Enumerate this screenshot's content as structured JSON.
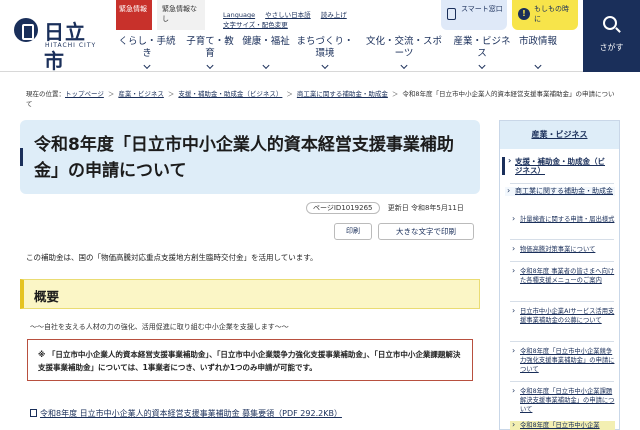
{
  "header": {
    "logo_title": "日立市",
    "logo_sub": "HITACHI CITY",
    "emergency_label": "緊急情報",
    "emergency_status": "緊急情報なし",
    "util_links": [
      "Language",
      "やさしい日本語",
      "読み上げ",
      "文字サイズ・配色変更"
    ],
    "smart_label": "スマート窓口",
    "if_label": "もしもの時に",
    "if_icon": "!",
    "search_label": "さがす"
  },
  "gnav": [
    {
      "label": "くらし・手続き"
    },
    {
      "label": "子育て・教育"
    },
    {
      "label": "健康・福祉"
    },
    {
      "label": "まちづくり・環境"
    },
    {
      "label": "文化・交流・スポーツ"
    },
    {
      "label": "産業・ビジネス"
    },
    {
      "label": "市政情報"
    }
  ],
  "breadcrumb": {
    "prefix": "現在の位置：",
    "items": [
      "トップページ",
      "産業・ビジネス",
      "支援・補助金・助成金（ビジネス）",
      "商工業に関する補助金・助成金"
    ],
    "current": "令和8年度「日立市中小企業人的資本経営支援事業補助金」の申請について",
    "separator": "＞"
  },
  "main": {
    "title": "令和8年度「日立市中小企業人的資本経営支援事業補助金」の申請について",
    "page_id": "ページID1019265",
    "updated": "更新日 令和8年5月11日",
    "print_label": "印刷",
    "print_big_label": "大きな文字で印刷",
    "intro": "この補助金は、国の「物価高騰対応重点支援地方創生臨時交付金」を活用しています。",
    "section_title": "概要",
    "subcopy": "～～自社を支える人材の力の強化、活用促進に取り組む中小企業を支援します～～",
    "notice": "※ 「日立市中小企業人的資本経営支援事業補助金」、「日立市中小企業競争力強化支援事業補助金」、「日立市中小企業課題解決支援事業補助金」については、1事業者につき、いずれか1つのみ申請が可能です。",
    "pdf_link": "令和8年度 日立市中小企業人的資本経営支援事業補助金 募集要領（PDF 292.2KB）"
  },
  "sidebar": {
    "head": "産業・ビジネス",
    "items": [
      {
        "label": "支援・補助金・助成金（ビジネス）"
      },
      {
        "label": "商工業に関する補助金・助成金"
      },
      {
        "label": "計量検査に関する申請・届出様式"
      },
      {
        "label": "物価高騰対策事業について"
      },
      {
        "label": "令和8年度 事業者の皆さまへ向けた各種支援メニューのご案内"
      },
      {
        "label": "日立市中小企業AIサービス活用支援事業補助金の公募について"
      },
      {
        "label": "令和8年度「日立市中小企業競争力強化支援事業補助金」の申請について"
      },
      {
        "label": "令和8年度「日立市中小企業課題解決支援事業補助金」の申請について"
      },
      {
        "label": "令和8年度「日立市中小企業"
      }
    ]
  },
  "colors": {
    "brand_navy": "#1a2f5a",
    "emergency_red": "#c8312b",
    "title_bg": "#deedf8",
    "section_bg": "#fbf6c6"
  }
}
